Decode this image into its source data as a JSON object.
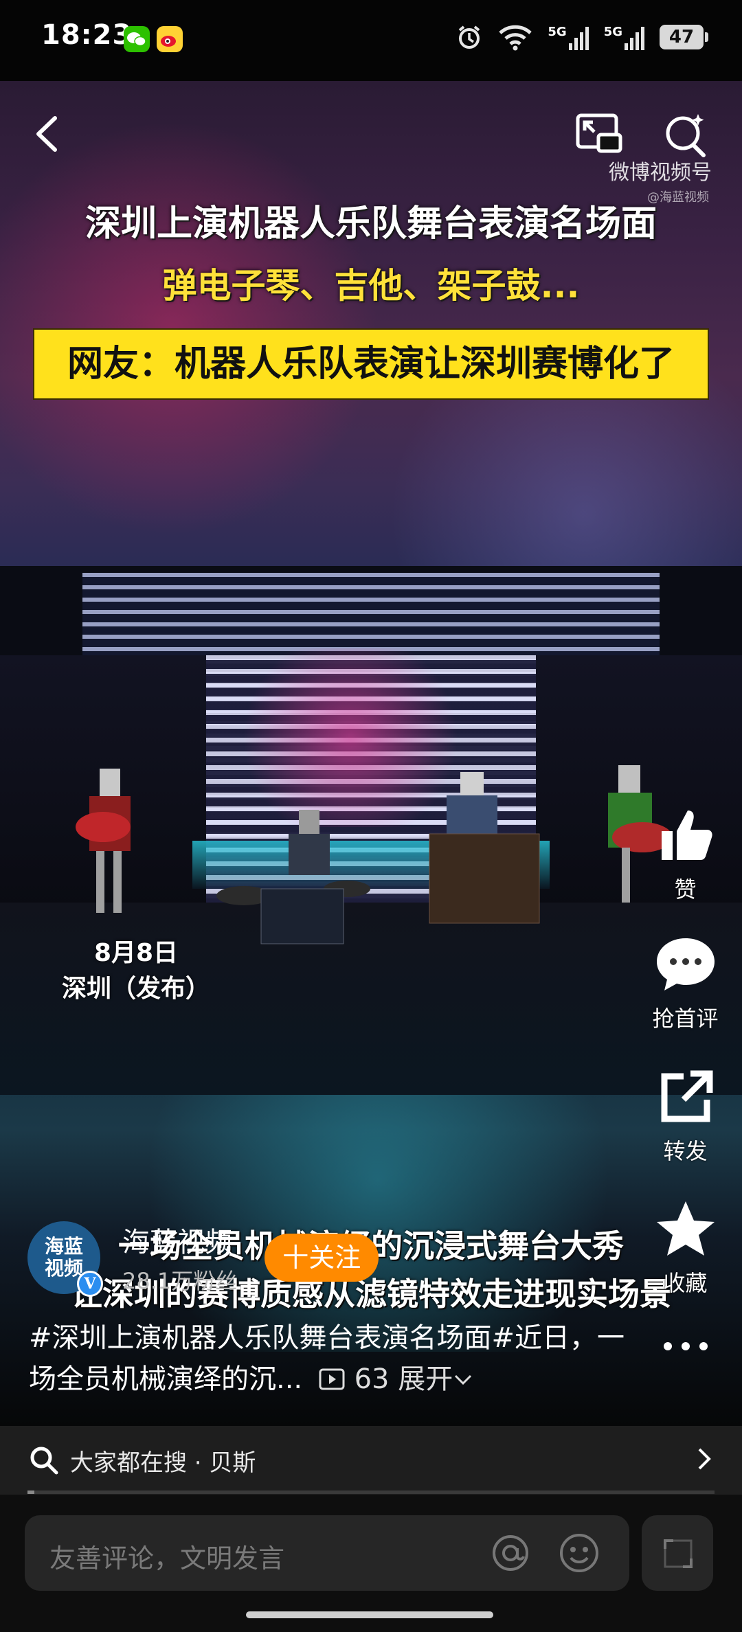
{
  "status_bar": {
    "time": "18:23",
    "apps": [
      "wechat-icon",
      "weibo-icon"
    ],
    "network1": "5G",
    "network2": "5G",
    "battery": "47"
  },
  "video": {
    "title_line": "深圳上演机器人乐队舞台表演名场面",
    "subtitle_line": "弹电子琴、吉他、架子鼓...",
    "banner": "网友：机器人乐队表演让深圳赛博化了",
    "watermark": "微博视频号",
    "watermark_sub": "@海蓝视频",
    "date_line1": "8月8日",
    "date_line2": "深圳（发布）",
    "caption_line1": "一场全员机械演绎的沉浸式舞台大秀",
    "caption_line2": "让深圳的赛博质感从滤镜特效走进现实场景"
  },
  "actions": {
    "like": "赞",
    "comment": "抢首评",
    "share": "转发",
    "favorite": "收藏"
  },
  "author": {
    "avatar_text_1": "海蓝",
    "avatar_text_2": "视频",
    "name": "海蓝视频",
    "fans": "28.1万粉丝",
    "follow_label": "十关注"
  },
  "description": {
    "hashtag": "#深圳上演机器人乐队舞台表演名场面#",
    "text": "近日，一场全员机械演绎的沉...",
    "play_count": "63",
    "expand_label": "展开"
  },
  "search": {
    "text": "大家都在搜 · 贝斯"
  },
  "progress": 0.01,
  "comment_bar": {
    "placeholder": "友善评论，文明发言"
  }
}
